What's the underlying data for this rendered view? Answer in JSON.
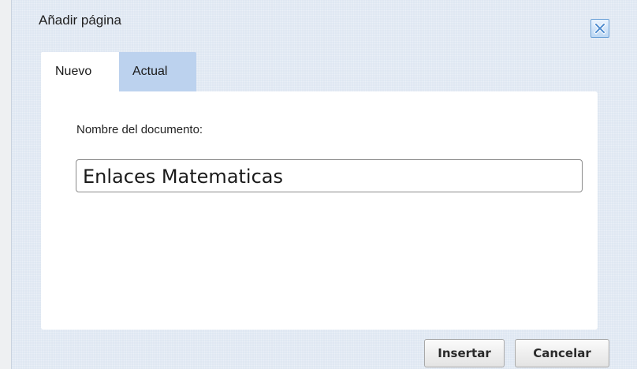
{
  "dialog": {
    "title": "Añadir página",
    "close_icon": "close-x-icon"
  },
  "tabs": [
    {
      "label": "Nuevo",
      "active": true
    },
    {
      "label": "Actual",
      "active": false
    }
  ],
  "form": {
    "label": "Nombre del documento:",
    "value": "Enlaces Matematicas"
  },
  "buttons": {
    "insert_label": "Insertar",
    "cancel_label": "Cancelar"
  },
  "colors": {
    "dialog_bg": "#dfe7f2",
    "inactive_tab": "#bcd2ee",
    "close_border": "#6aa0d6"
  }
}
